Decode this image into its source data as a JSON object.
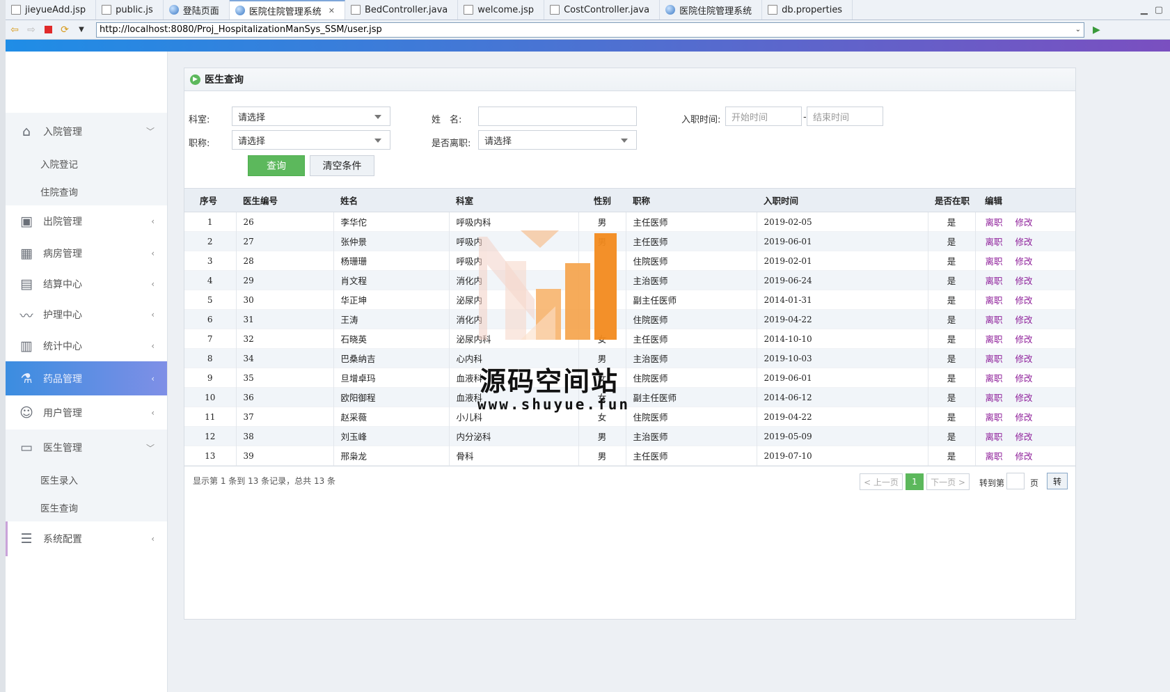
{
  "tabs": [
    {
      "label": "jieyueAdd.jsp",
      "icon": "file-icon",
      "active": false
    },
    {
      "label": "public.js",
      "icon": "file-icon",
      "active": false
    },
    {
      "label": "登陆页面",
      "icon": "globe-icon",
      "active": false
    },
    {
      "label": "医院住院管理系统",
      "icon": "globe-icon",
      "active": true
    },
    {
      "label": "BedController.java",
      "icon": "file-icon",
      "active": false
    },
    {
      "label": "welcome.jsp",
      "icon": "file-icon",
      "active": false
    },
    {
      "label": "CostController.java",
      "icon": "file-icon",
      "active": false
    },
    {
      "label": "医院住院管理系统",
      "icon": "globe-icon",
      "active": false
    },
    {
      "label": "db.properties",
      "icon": "file-icon",
      "active": false
    }
  ],
  "address": {
    "url": "http://localhost:8080/Proj_HospitalizationManSys_SSM/user.jsp"
  },
  "sidebar": {
    "admission": {
      "label": "入院管理",
      "icon": "home-icon",
      "subs": [
        "入院登记",
        "住院查询"
      ]
    },
    "discharge": {
      "label": "出院管理",
      "icon": "window-icon"
    },
    "ward": {
      "label": "病房管理",
      "icon": "building-icon"
    },
    "settlement": {
      "label": "结算中心",
      "icon": "map-icon"
    },
    "nursing": {
      "label": "护理中心",
      "icon": "trend-icon"
    },
    "stats": {
      "label": "统计中心",
      "icon": "bar-chart-icon"
    },
    "drugs": {
      "label": "药品管理",
      "icon": "flask-icon"
    },
    "users": {
      "label": "用户管理",
      "icon": "user-icon"
    },
    "doctors": {
      "label": "医生管理",
      "icon": "id-card-icon",
      "subs": [
        "医生录入",
        "医生查询"
      ]
    },
    "system": {
      "label": "系统配置",
      "icon": "list-icon"
    }
  },
  "panel": {
    "title": "医生查询"
  },
  "filter": {
    "dept_label": "科室:",
    "dept_value": "请选择",
    "name_label": "姓　名:",
    "name_value": "",
    "hire_label": "入职时间:",
    "start_placeholder": "开始时间",
    "date_sep": "-",
    "end_placeholder": "结束时间",
    "title_label": "职称:",
    "title_value": "请选择",
    "left_label": "是否离职:",
    "left_value": "请选择",
    "query_btn": "查询",
    "clear_btn": "清空条件"
  },
  "table": {
    "headers": [
      "序号",
      "医生编号",
      "姓名",
      "科室",
      "性别",
      "职称",
      "入职时间",
      "是否在职",
      "编辑"
    ],
    "resign_label": "离职",
    "edit_label": "修改",
    "rows": [
      [
        "1",
        "26",
        "李华佗",
        "呼吸内科",
        "男",
        "主任医师",
        "2019-02-05",
        "是"
      ],
      [
        "2",
        "27",
        "张仲景",
        "呼吸内",
        "男",
        "主任医师",
        "2019-06-01",
        "是"
      ],
      [
        "3",
        "28",
        "杨珊珊",
        "呼吸内",
        "",
        "住院医师",
        "2019-02-01",
        "是"
      ],
      [
        "4",
        "29",
        "肖文程",
        "消化内",
        "",
        "主治医师",
        "2019-06-24",
        "是"
      ],
      [
        "5",
        "30",
        "华正坤",
        "泌尿内",
        "",
        "副主任医师",
        "2014-01-31",
        "是"
      ],
      [
        "6",
        "31",
        "王涛",
        "消化内",
        "",
        "住院医师",
        "2019-04-22",
        "是"
      ],
      [
        "7",
        "32",
        "石晓英",
        "泌尿内科",
        "女",
        "主任医师",
        "2014-10-10",
        "是"
      ],
      [
        "8",
        "34",
        "巴桑纳吉",
        "心内科",
        "男",
        "主治医师",
        "2019-10-03",
        "是"
      ],
      [
        "9",
        "35",
        "旦增卓玛",
        "血液科",
        "女",
        "住院医师",
        "2019-06-01",
        "是"
      ],
      [
        "10",
        "36",
        "欧阳御程",
        "血液科",
        "女",
        "副主任医师",
        "2014-06-12",
        "是"
      ],
      [
        "11",
        "37",
        "赵采薇",
        "小儿科",
        "女",
        "住院医师",
        "2019-04-22",
        "是"
      ],
      [
        "12",
        "38",
        "刘玉峰",
        "内分泌科",
        "男",
        "主治医师",
        "2019-05-09",
        "是"
      ],
      [
        "13",
        "39",
        "邢枭龙",
        "骨科",
        "男",
        "主任医师",
        "2019-07-10",
        "是"
      ]
    ]
  },
  "pager": {
    "info": "显示第 1 条到 13 条记录，总共 13 条",
    "prev": "< 上一页",
    "current": "1",
    "next": "下一页 >",
    "goto_label": "转到第",
    "page_label": "页",
    "go_btn": "转"
  },
  "watermark": {
    "title": "源码空间站",
    "url": "www.shuyue.fun",
    "colors": [
      "#f7a14a",
      "#f39c3c",
      "#f2c9b8"
    ]
  }
}
